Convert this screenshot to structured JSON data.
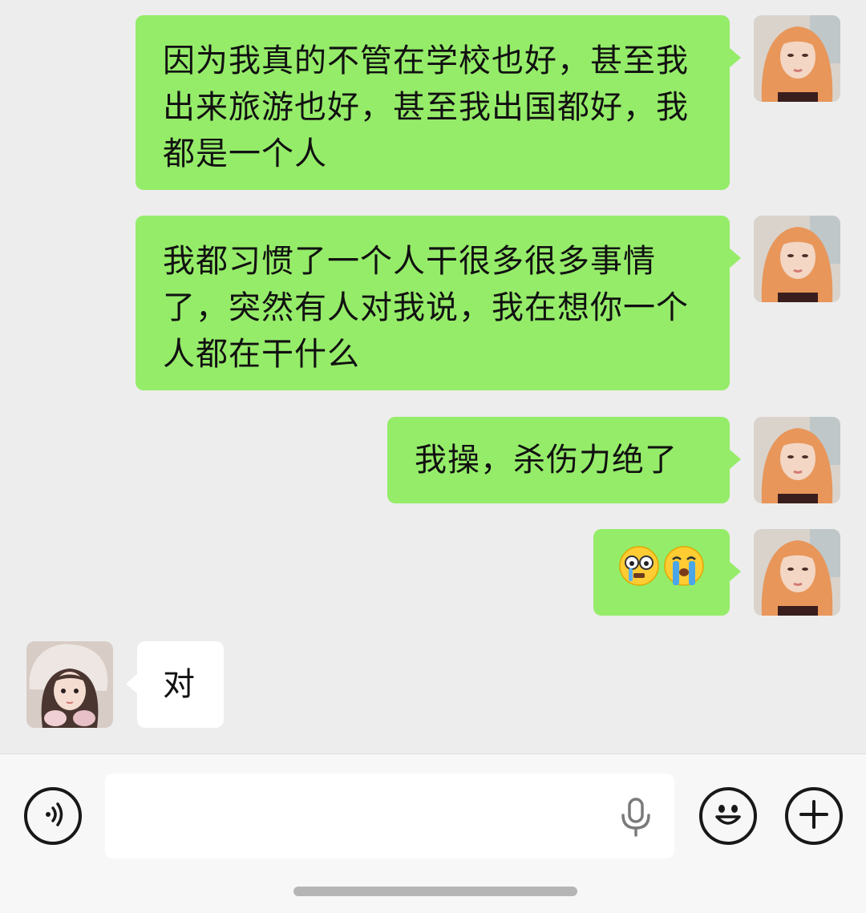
{
  "messages": [
    {
      "from": "self",
      "text": "因为我真的不管在学校也好，甚至我出来旅游也好，甚至我出国都好，我都是一个人"
    },
    {
      "from": "self",
      "text": "我都习惯了一个人干很多很多事情了，突然有人对我说，我在想你一个人都在干什么"
    },
    {
      "from": "self",
      "text": "我操，杀伤力绝了"
    },
    {
      "from": "self",
      "emojis": [
        "scared-emoji",
        "crying-emoji"
      ]
    },
    {
      "from": "other",
      "text": "对"
    }
  ],
  "input": {
    "value": ""
  },
  "icons": {
    "voice": "voice-icon",
    "mic": "microphone-icon",
    "emoji": "smiley-icon",
    "plus": "plus-icon"
  },
  "colors": {
    "background": "#ededed",
    "self_bubble": "#95ec69",
    "other_bubble": "#ffffff"
  }
}
